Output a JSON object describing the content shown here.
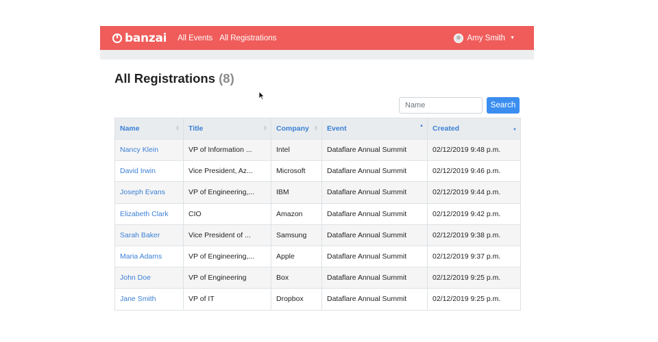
{
  "app": {
    "brand": "banzai",
    "brand_color": "#ef5c5a"
  },
  "nav": {
    "links": [
      "All Events",
      "All Registrations"
    ]
  },
  "user": {
    "name": "Amy Smith"
  },
  "page": {
    "title": "All Registrations",
    "count": "(8)"
  },
  "search": {
    "placeholder": "Name",
    "button": "Search"
  },
  "table": {
    "columns": [
      "Name",
      "Title",
      "Company",
      "Event",
      "Created"
    ],
    "sort": {
      "Event": "ascending-highlight",
      "Created": "descending-highlight"
    },
    "rows": [
      {
        "name": "Nancy Klein",
        "title": "VP of Information ...",
        "company": "Intel",
        "event": "Dataflare Annual Summit",
        "created": "02/12/2019 9:48 p.m."
      },
      {
        "name": "David Irwin",
        "title": "Vice President, Az...",
        "company": "Microsoft",
        "event": "Dataflare Annual Summit",
        "created": "02/12/2019 9:46 p.m."
      },
      {
        "name": "Joseph Evans",
        "title": "VP of Engineering,...",
        "company": "IBM",
        "event": "Dataflare Annual Summit",
        "created": "02/12/2019 9:44 p.m."
      },
      {
        "name": "Elizabeth Clark",
        "title": "CIO",
        "company": "Amazon",
        "event": "Dataflare Annual Summit",
        "created": "02/12/2019 9:42 p.m."
      },
      {
        "name": "Sarah Baker",
        "title": "Vice President of ...",
        "company": "Samsung",
        "event": "Dataflare Annual Summit",
        "created": "02/12/2019 9:38 p.m."
      },
      {
        "name": "Maria Adams",
        "title": "VP of Engineering,...",
        "company": "Apple",
        "event": "Dataflare Annual Summit",
        "created": "02/12/2019 9:37 p.m."
      },
      {
        "name": "John Doe",
        "title": "VP of Engineering",
        "company": "Box",
        "event": "Dataflare Annual Summit",
        "created": "02/12/2019 9:25 p.m."
      },
      {
        "name": "Jane Smith",
        "title": "VP of IT",
        "company": "Dropbox",
        "event": "Dataflare Annual Summit",
        "created": "02/12/2019 9:25 p.m."
      }
    ]
  },
  "icons": {
    "brand": "banzai-logo-icon",
    "avatar": "user-avatar-icon",
    "caret": "caret-down-icon",
    "cursor": "mouse-pointer-icon"
  }
}
